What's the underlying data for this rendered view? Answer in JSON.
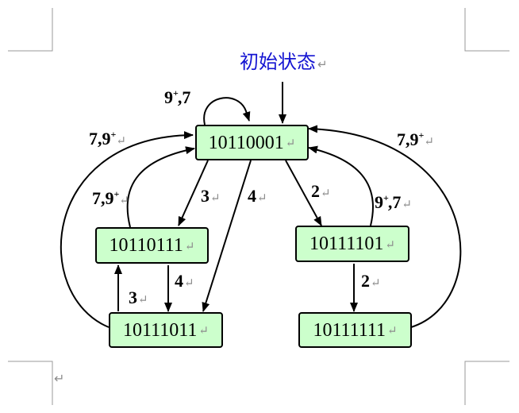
{
  "title": "初始状态",
  "return_mark": "↵",
  "nodes": {
    "n10110001": "10110001",
    "n10110111": "10110111",
    "n10111101": "10111101",
    "n10111011": "10111011",
    "n10111111": "10111111"
  },
  "labels": {
    "self_loop": {
      "main": "9",
      "sup": "+",
      "rest": ",7"
    },
    "left_outer": {
      "main": "7,9",
      "sup": "+"
    },
    "left_inner": {
      "main": "7,9",
      "sup": "+"
    },
    "right_outer": {
      "main": "7,9",
      "sup": "+"
    },
    "right_inner": {
      "main": "9",
      "sup": "+",
      "rest": ",7"
    },
    "e3_top": "3",
    "e4_top": "4",
    "e2_top": "2",
    "e4_mid": "4",
    "e3_mid": "3",
    "e2_mid": "2"
  },
  "colors": {
    "node_fill": "#ccffcc",
    "title": "#1414d2",
    "mark": "#8c8c8c"
  }
}
